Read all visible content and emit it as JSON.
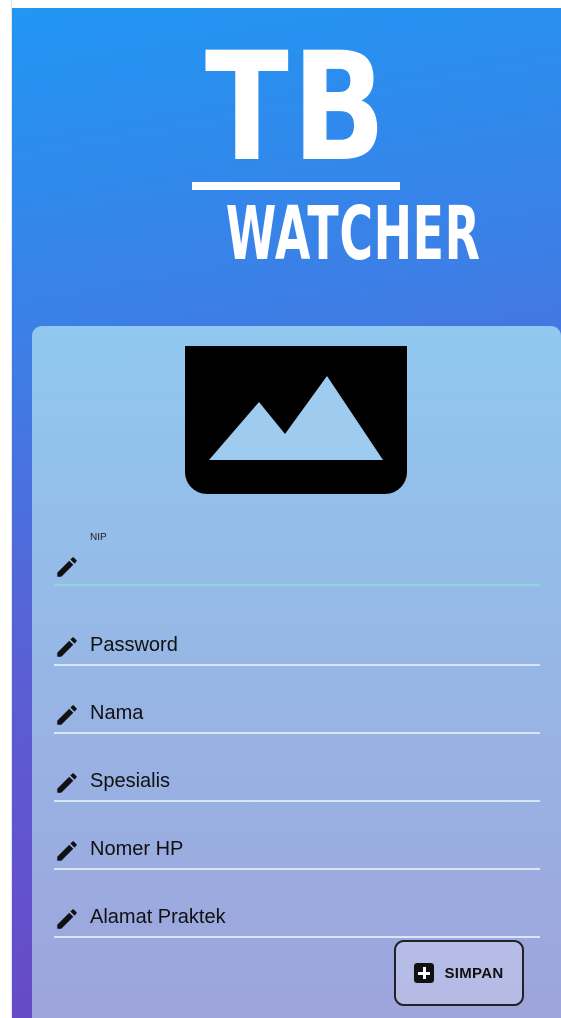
{
  "logo": {
    "line1": "TB",
    "line2": "WATCHER"
  },
  "photo": {
    "icon": "image-placeholder-icon"
  },
  "form": {
    "fields": [
      {
        "label": "",
        "floating_label": "NIP",
        "icon": "pencil-icon"
      },
      {
        "label": "Password",
        "icon": "pencil-icon"
      },
      {
        "label": "Nama",
        "icon": "pencil-icon"
      },
      {
        "label": "Spesialis",
        "icon": "pencil-icon"
      },
      {
        "label": "Nomer HP",
        "icon": "pencil-icon"
      },
      {
        "label": "Alamat Praktek",
        "icon": "pencil-icon"
      }
    ],
    "save_label": "SIMPAN",
    "save_icon": "add-box-icon"
  },
  "colors": {
    "gradient_top": "#2196f3",
    "gradient_bottom": "#6a44c2",
    "card_top": "#90c8ef"
  }
}
